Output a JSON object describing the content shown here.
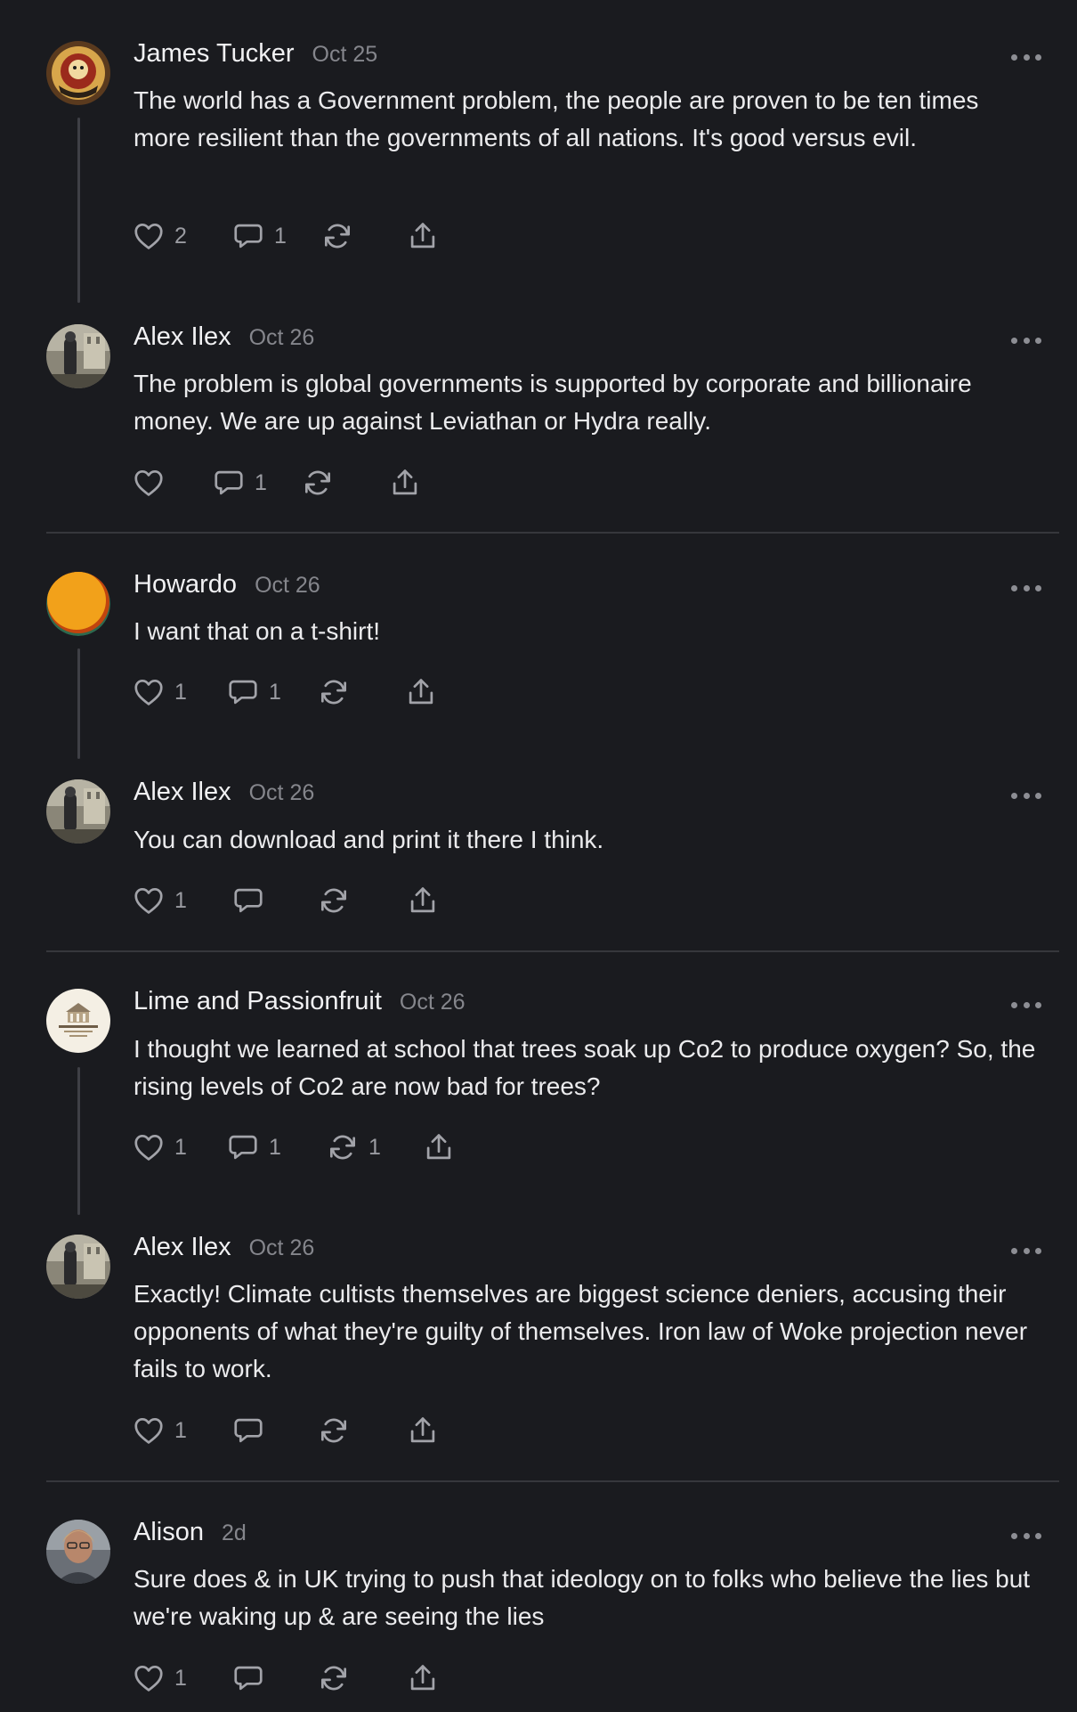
{
  "colors": {
    "background": "#1a1b1f",
    "text": "#ebebed",
    "muted": "#85868c",
    "divider": "#36373c",
    "thread_line": "#3f4046"
  },
  "comments": [
    {
      "author": "James Tucker",
      "date": "Oct 25",
      "avatar": "squadron-badge-avatar",
      "text": "The world has a Government problem, the people are proven to be ten times more resilient than the governments of all nations. It's good versus evil.",
      "likes": "2",
      "replies": "1",
      "reposts": ""
    },
    {
      "author": "Alex Ilex",
      "date": "Oct 26",
      "avatar": "statue-photo-avatar",
      "text": "The problem is global governments is supported by corporate and billionaire money. We are up against Leviathan or Hydra really.",
      "likes": "",
      "replies": "1",
      "reposts": ""
    },
    {
      "author": "Howardo",
      "date": "Oct 26",
      "avatar": "orange-circle-avatar",
      "text": "I want that on a t-shirt!",
      "likes": "1",
      "replies": "1",
      "reposts": ""
    },
    {
      "author": "Alex Ilex",
      "date": "Oct 26",
      "avatar": "statue-photo-avatar",
      "text": "You can download and print it there I think.",
      "likes": "1",
      "replies": "",
      "reposts": ""
    },
    {
      "author": "Lime and Passionfruit",
      "date": "Oct 26",
      "avatar": "publication-logo-avatar",
      "text": "I thought we learned at school that trees soak up Co2 to produce oxygen? So, the rising levels of Co2 are now bad for trees?",
      "likes": "1",
      "replies": "1",
      "reposts": "1"
    },
    {
      "author": "Alex Ilex",
      "date": "Oct 26",
      "avatar": "statue-photo-avatar",
      "text": "Exactly! Climate cultists themselves are biggest science deniers, accusing their opponents of what they're guilty of themselves. Iron law of Woke projection never fails to work.",
      "likes": "1",
      "replies": "",
      "reposts": ""
    },
    {
      "author": "Alison",
      "date": "2d",
      "avatar": "person-photo-avatar",
      "text": "Sure does & in UK trying to push that ideology on to folks who believe the lies but we're waking up & are seeing the lies",
      "likes": "1",
      "replies": "",
      "reposts": ""
    }
  ]
}
